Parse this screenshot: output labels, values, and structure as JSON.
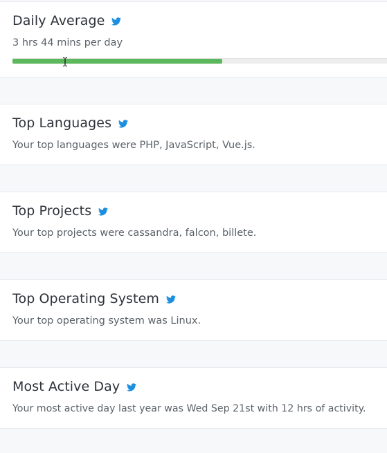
{
  "colors": {
    "accent_green": "#5cb85c",
    "twitter_blue": "#1d8fe1"
  },
  "icons": {
    "share": "twitter-icon",
    "cursor": "text-cursor-icon"
  },
  "cards": [
    {
      "title": "Daily Average",
      "text": "3 hrs 44 mins per day",
      "progress": 0.56
    },
    {
      "title": "Top Languages",
      "text": "Your top languages were PHP, JavaScript, Vue.js."
    },
    {
      "title": "Top Projects",
      "text": "Your top projects were cassandra, falcon, billete."
    },
    {
      "title": "Top Operating System",
      "text": "Your top operating system was Linux."
    },
    {
      "title": "Most Active Day",
      "text": "Your most active day last year was Wed Sep 21st with 12 hrs of activity."
    }
  ]
}
